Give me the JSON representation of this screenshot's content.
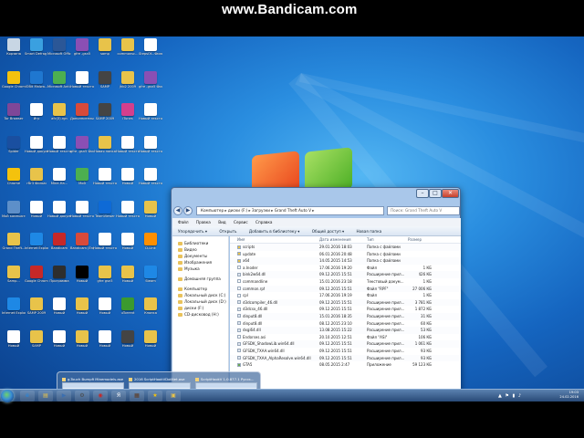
{
  "watermark": "www.Bandicam.com",
  "desktop_icons": [
    {
      "label": "Корзина",
      "color": "#c8d6e4"
    },
    {
      "label": "Smart Defrag 4",
      "color": "#3aa0e0"
    },
    {
      "label": "Microsoft Office Wo...",
      "color": "#2b5797"
    },
    {
      "label": "gfre -gsn5",
      "color": "#8a4fb4"
    },
    {
      "label": "samp",
      "color": "#e8c34a"
    },
    {
      "label": "commonsc...",
      "color": "#e8c34a"
    },
    {
      "label": "StepsOf...Фильм",
      "color": "#ffffff"
    },
    {
      "label": "Google Chrome",
      "color": "#f4c20d"
    },
    {
      "label": "iOBit Malwa...",
      "color": "#1f77d0"
    },
    {
      "label": "Microsoft Anti-Malware",
      "color": "#4caf50"
    },
    {
      "label": "Новый текстовый...",
      "color": "#ffffff"
    },
    {
      "label": "SAMP",
      "color": "#444444"
    },
    {
      "label": "jhb2 2009",
      "color": "#e8c34a"
    },
    {
      "label": "gfre -gsn5 Фильм",
      "color": "#8a4fb4"
    },
    {
      "label": "Tor Browser",
      "color": "#7e4798"
    },
    {
      "label": "Игр",
      "color": "#ffffff"
    },
    {
      "label": "afc(3).rgn",
      "color": "#e8c34a"
    },
    {
      "label": "Дополнительно",
      "color": "#d84a3a"
    },
    {
      "label": "SAMP 2009",
      "color": "#444444"
    },
    {
      "label": "iTunes",
      "color": "#d43f8d"
    },
    {
      "label": "Новый текстовый...",
      "color": "#ffffff"
    },
    {
      "label": "Spider",
      "color": "#1a4fa0"
    },
    {
      "label": "Новый документ",
      "color": "#ffffff"
    },
    {
      "label": "Новый текстовый",
      "color": "#ffffff"
    },
    {
      "label": "gfre -gsn5 Фильм",
      "color": "#8a4fb4"
    },
    {
      "label": "Новая папка",
      "color": "#e8c34a"
    },
    {
      "label": "Новый текстовый...",
      "color": "#ffffff"
    },
    {
      "label": "Новый текстовый...",
      "color": "#ffffff"
    },
    {
      "label": "Chrome",
      "color": "#f4c20d"
    },
    {
      "label": "гбr3 Фильм",
      "color": "#e8c34a"
    },
    {
      "label": "Mine-Ha...",
      "color": "#ffffff"
    },
    {
      "label": "Мой",
      "color": "#4caf50"
    },
    {
      "label": "Новый текстовый",
      "color": "#ffffff"
    },
    {
      "label": "Новый",
      "color": "#ffffff"
    },
    {
      "label": "Новый текстовый...",
      "color": "#ffffff"
    },
    {
      "label": "Мой компьютер",
      "color": "#5d8fc9"
    },
    {
      "label": "Новый",
      "color": "#ffffff"
    },
    {
      "label": "Новый документ",
      "color": "#ffffff"
    },
    {
      "label": "Новый текстовый",
      "color": "#ffffff"
    },
    {
      "label": "TeamViewer",
      "color": "#0e6ad6"
    },
    {
      "label": "Новый текстовый...",
      "color": "#ffffff"
    },
    {
      "label": "Новый",
      "color": "#e8c34a"
    },
    {
      "label": "Grand Theft...",
      "color": "#e8c34a"
    },
    {
      "label": "Internet Explorer",
      "color": "#1e88e5"
    },
    {
      "label": "Bandicam",
      "color": "#c62828"
    },
    {
      "label": "Bandicam (English)",
      "color": "#d84a3a"
    },
    {
      "label": "Новый текстовый",
      "color": "#ffffff"
    },
    {
      "label": "Новый",
      "color": "#ffffff"
    },
    {
      "label": "D-Link",
      "color": "#ff8f00"
    },
    {
      "label": "Samp...",
      "color": "#e8c34a"
    },
    {
      "label": "Google Chrome",
      "color": "#c62828"
    },
    {
      "label": "Программа",
      "color": "#2e2e2e"
    },
    {
      "label": "Новый",
      "color": "#000000"
    },
    {
      "label": "gfre gsn5",
      "color": "#e8c34a"
    },
    {
      "label": "Новый",
      "color": "#e8c34a"
    },
    {
      "label": "Steam",
      "color": "#1e88e5"
    },
    {
      "label": "Internet Explorer",
      "color": "#1e88e5"
    },
    {
      "label": "SAMP 2009",
      "color": "#e8c34a"
    },
    {
      "label": "Новый",
      "color": "#ffffff"
    },
    {
      "label": "Новый",
      "color": "#e8c34a"
    },
    {
      "label": "Новый",
      "color": "#ffffff"
    },
    {
      "label": "uTorrent",
      "color": "#3b9a2f"
    },
    {
      "label": "Кнопка",
      "color": "#e8c34a"
    },
    {
      "label": "Новый",
      "color": "#ffffff"
    },
    {
      "label": "SAMP",
      "color": "#e8c34a"
    },
    {
      "label": "Новый",
      "color": "#ffffff"
    },
    {
      "label": "Новый",
      "color": "#e8c34a"
    },
    {
      "label": "Новый",
      "color": "#ffffff"
    },
    {
      "label": "Новый",
      "color": "#444444"
    },
    {
      "label": "Новый",
      "color": "#e8c34a"
    }
  ],
  "explorer": {
    "title_buttons": {
      "min": "–",
      "max": "□",
      "close": "✕"
    },
    "address": "Компьютер ▸ диски (F:) ▸ Загрузки ▸ Grand Theft Auto V ▸",
    "search_placeholder": "Поиск: Grand Theft Auto V",
    "menu": [
      "Файл",
      "Правка",
      "Вид",
      "Сервис",
      "Справка"
    ],
    "toolbar": [
      "Упорядочить ▾",
      "Открыть",
      "Добавить в библиотеку ▾",
      "Общий доступ ▾",
      "Новая папка"
    ],
    "nav_items": [
      {
        "label": "Библиотеки",
        "gap": false
      },
      {
        "label": "Видео",
        "gap": false
      },
      {
        "label": "Документы",
        "gap": false
      },
      {
        "label": "Изображения",
        "gap": false
      },
      {
        "label": "Музыка",
        "gap": false
      },
      {
        "label": "Домашняя группа",
        "gap": true
      },
      {
        "label": "Компьютер",
        "gap": true
      },
      {
        "label": "Локальный диск (C:)",
        "gap": false
      },
      {
        "label": "Локальный диск (D:)",
        "gap": false
      },
      {
        "label": "диски (F:)",
        "gap": false
      },
      {
        "label": "CD-дисковод (H:)",
        "gap": false
      }
    ],
    "columns": {
      "name": "Имя",
      "date": "Дата изменения",
      "type": "Тип",
      "size": "Размер"
    },
    "files": [
      {
        "name": "scripts",
        "date": "29.01.2016 18:03",
        "type": "Папка с файлами",
        "size": "",
        "icon": "#e8c34a"
      },
      {
        "name": "update",
        "date": "06.01.2016 20:48",
        "type": "Папка с файлами",
        "size": "",
        "icon": "#e8c34a"
      },
      {
        "name": "x64",
        "date": "14.05.2015 14:53",
        "type": "Папка с файлами",
        "size": "",
        "icon": "#e8c34a"
      },
      {
        "name": "a.Inoder",
        "date": "17.06.2016 19:20",
        "type": "Файл",
        "size": "1 КБ",
        "icon": "#ffffff"
      },
      {
        "name": "bink2w64.dll",
        "date": "09.12.2015 15:51",
        "type": "Расширение прил...",
        "size": "426 КБ",
        "icon": "#dfe6ef"
      },
      {
        "name": "commandline",
        "date": "15.01.2016 23:18",
        "type": "Текстовый докум...",
        "size": "1 КБ",
        "icon": "#ffffff"
      },
      {
        "name": "common.rpf",
        "date": "09.12.2015 15:51",
        "type": "Файл \"RPF\"",
        "size": "27 006 КБ",
        "icon": "#ffffff"
      },
      {
        "name": "cpl",
        "date": "17.06.2016 19:19",
        "type": "Файл",
        "size": "1 КБ",
        "icon": "#ffffff"
      },
      {
        "name": "d3dcompiler_46.dll",
        "date": "09.12.2015 15:51",
        "type": "Расширение прил...",
        "size": "3 781 КБ",
        "icon": "#dfe6ef"
      },
      {
        "name": "d3dcsx_46.dll",
        "date": "09.12.2015 15:51",
        "type": "Расширение прил...",
        "size": "1 872 КБ",
        "icon": "#dfe6ef"
      },
      {
        "name": "dinput8.dll",
        "date": "15.01.2016 18:35",
        "type": "Расширение прил...",
        "size": "31 КБ",
        "icon": "#dfe6ef"
      },
      {
        "name": "dinput8.dll",
        "date": "08.12.2015 23:10",
        "type": "Расширение прил...",
        "size": "60 КБ",
        "icon": "#dfe6ef"
      },
      {
        "name": "dxgi64.dll",
        "date": "13.08.2015 15:22",
        "type": "Расширение прил...",
        "size": "53 КБ",
        "icon": "#dfe6ef"
      },
      {
        "name": "Endorses.asi",
        "date": "20.10.2015 12:51",
        "type": "Файл \"ASI\"",
        "size": "106 КБ",
        "icon": "#ffffff"
      },
      {
        "name": "GFSDK_ShadowLib.win64.dll",
        "date": "09.12.2015 15:51",
        "type": "Расширение прил...",
        "size": "1 061 КБ",
        "icon": "#dfe6ef"
      },
      {
        "name": "GFSDK_TXAA.win64.dll",
        "date": "09.12.2015 15:51",
        "type": "Расширение прил...",
        "size": "93 КБ",
        "icon": "#dfe6ef"
      },
      {
        "name": "GFSDK_TXAA_AlphaResolve.win64.dll",
        "date": "09.12.2015 15:51",
        "type": "Расширение прил...",
        "size": "93 КБ",
        "icon": "#dfe6ef"
      },
      {
        "name": "GTA5",
        "date": "08.05.2015 2:47",
        "type": "Приложение",
        "size": "59 123 КБ",
        "icon": "#6aa84f"
      }
    ],
    "status": "Изменено: 24.02.2016 19:03"
  },
  "thumbnails": [
    {
      "title": "g-Touch Bumpfi Minemodels.ase"
    },
    {
      "title": "2016 ScriptHookVDotNet.ase"
    },
    {
      "title": "ScriptHookV 1.0.877.1 Русск..."
    }
  ],
  "taskbar": {
    "start_label": "Пуск",
    "items": [
      {
        "glyph": "e",
        "color": "#1e88e5"
      },
      {
        "glyph": "▤",
        "color": "#e8c34a"
      },
      {
        "glyph": "▶",
        "color": "#3b6fb0"
      },
      {
        "glyph": "⚙",
        "color": "#4a4a4a"
      },
      {
        "glyph": "◉",
        "color": "#c62828"
      },
      {
        "glyph": "Я",
        "color": "#ffffff"
      },
      {
        "glyph": "▦",
        "color": "#5f3a1f"
      },
      {
        "glyph": "★",
        "color": "#f4c20d"
      },
      {
        "glyph": "▣",
        "color": "#e8c34a"
      }
    ],
    "tray_icons": "▲ ⚑ ▮ ♪",
    "time": "19:03",
    "date": "24.02.2016"
  }
}
